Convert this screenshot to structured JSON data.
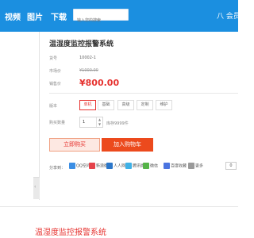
{
  "nav": {
    "items": [
      "视频",
      "图片",
      "下载"
    ],
    "search_placeholder": "输入您的搜索",
    "user_text": "八 会员"
  },
  "product": {
    "title": "温湿度监控报警系统",
    "code_label": "货号",
    "code": "10002-1",
    "market_label": "市场价",
    "market_price": "¥1000.00",
    "sale_label": "销售价",
    "sale_price": "¥800.00",
    "spec_label": "版本",
    "options": [
      "单机",
      "基础",
      "高级",
      "定制",
      "维护"
    ],
    "qty_label": "购买数量",
    "qty": "1",
    "stock": "库存9999件",
    "buy_now": "立即购买",
    "add_cart": "加入购物车"
  },
  "share": {
    "label": "分享到：",
    "items": [
      "QQ空间",
      "新浪微博",
      "人人网",
      "腾讯微博",
      "微信",
      "百度收藏"
    ],
    "more": "更多",
    "count": "0",
    "icons": [
      {
        "name": "qzone-icon",
        "color": "#3b8ee4"
      },
      {
        "name": "weibo-icon",
        "color": "#e5434b"
      },
      {
        "name": "renren-icon",
        "color": "#2c77c9"
      },
      {
        "name": "tencent-weibo-icon",
        "color": "#3fb1e6"
      },
      {
        "name": "wechat-icon",
        "color": "#55b348"
      },
      {
        "name": "baidu-icon",
        "color": "#4b74e0"
      },
      {
        "name": "more-icon",
        "color": "#9a9a9a"
      }
    ]
  },
  "slider_arrow": "‹",
  "bottom_title": "温湿度监控报警系统",
  "colors": {
    "topbar": "#1b8fe0",
    "price_red": "#e6322f",
    "cart_button": "#ec4a1d",
    "buy_now_bg": "#fde8e2"
  }
}
